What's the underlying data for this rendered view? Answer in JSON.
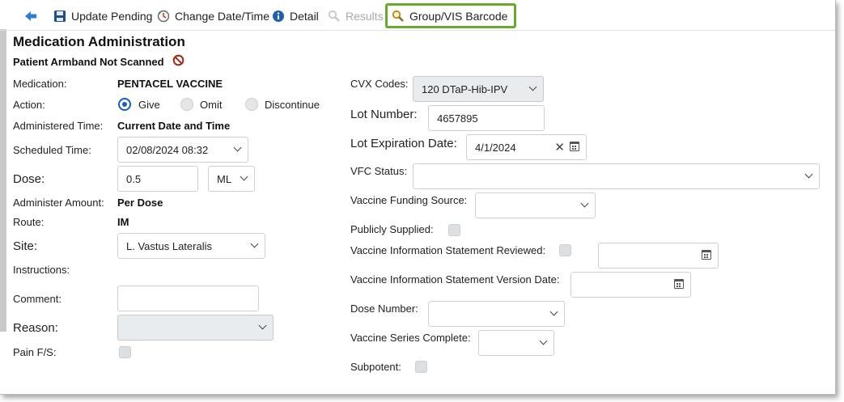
{
  "toolbar": {
    "update_pending": "Update Pending",
    "change_datetime": "Change Date/Time",
    "detail": "Detail",
    "results": "Results",
    "group_vis_barcode": "Group/VIS Barcode"
  },
  "header": {
    "title": "Medication Administration",
    "armband_warning": "Patient Armband Not Scanned"
  },
  "left": {
    "medication_label": "Medication:",
    "medication_value": "PENTACEL VACCINE",
    "action_label": "Action:",
    "action_give": "Give",
    "action_omit": "Omit",
    "action_discontinue": "Discontinue",
    "action_selected": "Give",
    "administered_time_label": "Administered Time:",
    "administered_time_value": "Current Date and Time",
    "scheduled_time_label": "Scheduled Time:",
    "scheduled_time_value": "02/08/2024 08:32",
    "dose_label": "Dose:",
    "dose_value": "0.5",
    "dose_unit": "ML",
    "administer_amount_label": "Administer Amount:",
    "administer_amount_value": "Per Dose",
    "route_label": "Route:",
    "route_value": "IM",
    "site_label": "Site:",
    "site_value": "L. Vastus Lateralis",
    "instructions_label": "Instructions:",
    "comment_label": "Comment:",
    "comment_value": "",
    "reason_label": "Reason:",
    "reason_value": "",
    "pain_label": "Pain F/S:"
  },
  "right": {
    "cvx_label": "CVX Codes:",
    "cvx_value": "120 DTaP-Hib-IPV",
    "lot_number_label": "Lot Number:",
    "lot_number_value": "4657895",
    "lot_expiration_label": "Lot Expiration Date:",
    "lot_expiration_value": "4/1/2024",
    "vfc_status_label": "VFC Status:",
    "vfc_status_value": "",
    "funding_source_label": "Vaccine Funding Source:",
    "funding_source_value": "",
    "publicly_supplied_label": "Publicly Supplied:",
    "vis_reviewed_label": "Vaccine Information Statement Reviewed:",
    "vis_reviewed_date": "",
    "vis_version_label": "Vaccine Information Statement Version Date:",
    "vis_version_date": "",
    "dose_number_label": "Dose Number:",
    "dose_number_value": "",
    "series_complete_label": "Vaccine Series Complete:",
    "series_complete_value": "",
    "subpotent_label": "Subpotent:"
  },
  "colors": {
    "highlight_border": "#69a92c",
    "accent_blue": "#1560bd",
    "warning_red": "#c0392b"
  },
  "icons": {
    "back": "back-arrow-icon",
    "save": "floppy-disk-icon",
    "change_datetime": "clock-refresh-icon",
    "detail": "info-icon",
    "results": "magnifier-icon",
    "group_vis": "magnifier-icon",
    "armband": "no-symbol-icon"
  }
}
